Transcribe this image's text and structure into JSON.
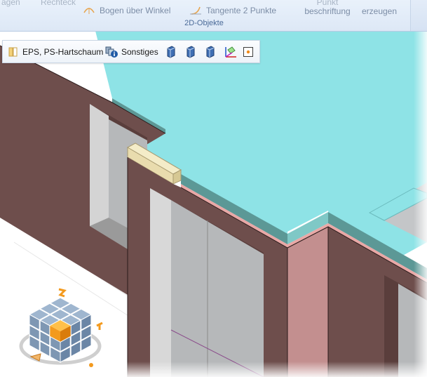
{
  "ribbon": {
    "top_left_fragment": "agen",
    "top_rect_fragment": "Rechteck",
    "arc_button_label": "Bogen über Winkel",
    "tangent_button_label": "Tangente 2 Punkte",
    "point_label_line1": "Punkt",
    "point_label_line2": "beschriftung",
    "create_label_line1": "",
    "create_label_line2": "erzeugen",
    "group_title": "2D-Objekte"
  },
  "toolbar": {
    "material_label": "EPS, PS-Hartschaum",
    "misc_label": "Sonstiges"
  },
  "viewcube": {
    "active_face": "front-top-right"
  },
  "colors": {
    "wall_brown": "#6e4e4c",
    "wall_pink": "#c38f8f",
    "top_cyan": "#8ee3e6",
    "glass_grey": "#b6b8ba",
    "ribbon_bg": "#dde8f6",
    "accent_orange": "#f39a1e"
  }
}
